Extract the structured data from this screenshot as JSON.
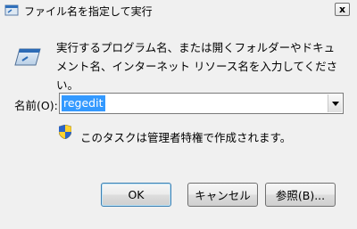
{
  "window": {
    "title": "ファイル名を指定して実行",
    "close_label": "x"
  },
  "dialog": {
    "description": "実行するプログラム名、または開くフォルダーやドキュメント名、インターネット リソース名を入力してください。",
    "name_label": "名前(O):",
    "name_value": "regedit",
    "admin_note": "このタスクは管理者特権で作成されます。"
  },
  "buttons": {
    "ok": "OK",
    "cancel": "キャンセル",
    "browse": "参照(B)..."
  },
  "icons": {
    "title": "run-app-icon",
    "main": "run-program-icon",
    "shield": "uac-shield-icon",
    "dropdown": "chevron-down-icon"
  },
  "colors": {
    "selection": "#3399ff",
    "background": "#f0f0f0"
  }
}
